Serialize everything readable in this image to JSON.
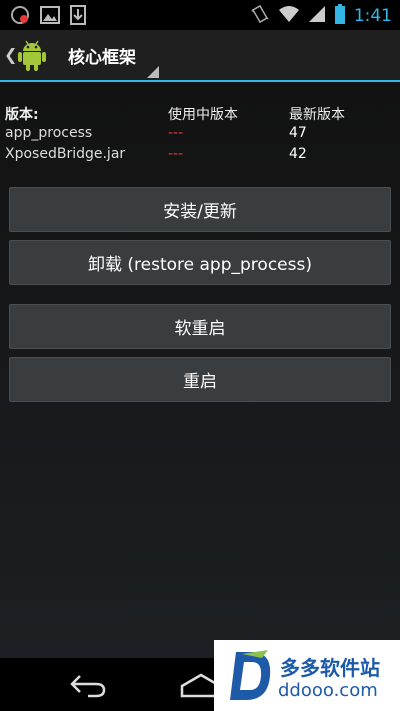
{
  "status_bar": {
    "time": "1:41",
    "left_icons": [
      "notification-app-icon",
      "gallery-icon",
      "download-icon"
    ],
    "right_icons": [
      "vibrate-icon",
      "wifi-icon",
      "signal-icon",
      "battery-icon"
    ]
  },
  "action_bar": {
    "title": "核心框架"
  },
  "versions": {
    "header": {
      "label": "版本:",
      "installed": "使用中版本",
      "latest": "最新版本"
    },
    "rows": [
      {
        "name": "app_process",
        "installed": "---",
        "latest": "47"
      },
      {
        "name": "XposedBridge.jar",
        "installed": "---",
        "latest": "42"
      }
    ]
  },
  "buttons": {
    "install_update": "安装/更新",
    "uninstall": "卸载 (restore app_process)",
    "soft_reboot": "软重启",
    "reboot": "重启"
  },
  "watermark": {
    "name": "多多软件站",
    "url": "ddooo.com"
  },
  "colors": {
    "accent": "#33b5e5",
    "missing": "#e53935",
    "button_bg": "#3a3d40"
  }
}
